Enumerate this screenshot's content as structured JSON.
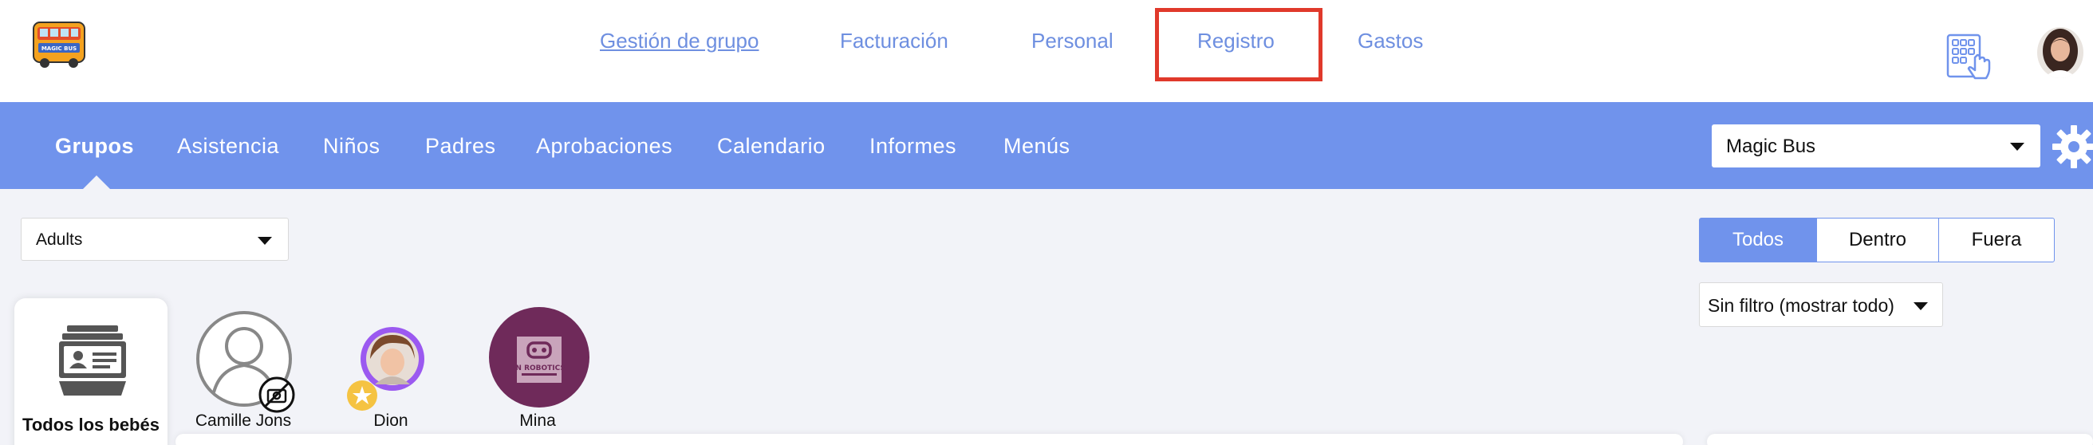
{
  "topnav": {
    "logo_text": "MAGIC BUS",
    "items": [
      {
        "label": "Gestión de grupo"
      },
      {
        "label": "Facturación"
      },
      {
        "label": "Personal"
      },
      {
        "label": "Registro"
      },
      {
        "label": "Gastos"
      }
    ]
  },
  "mainnav": {
    "items": [
      {
        "label": "Grupos"
      },
      {
        "label": "Asistencia"
      },
      {
        "label": "Niños"
      },
      {
        "label": "Padres"
      },
      {
        "label": "Aprobaciones"
      },
      {
        "label": "Calendario"
      },
      {
        "label": "Informes"
      },
      {
        "label": "Menús"
      }
    ],
    "center_select": "Magic Bus"
  },
  "content": {
    "group_select": "Adults",
    "segments": [
      "Todos",
      "Dentro",
      "Fuera"
    ],
    "filter_select": "Sin filtro (mostrar todo)",
    "all_card_label": "Todos los bebés",
    "children": [
      {
        "name": "Camille Jons"
      },
      {
        "name": "Dion"
      },
      {
        "name": "Mina",
        "avatar_text": "IN ROBOTICS"
      }
    ]
  },
  "colors": {
    "accent": "#7093ec",
    "highlight": "#e0392b",
    "link": "#6e8fe0",
    "background": "#f2f3f8"
  }
}
